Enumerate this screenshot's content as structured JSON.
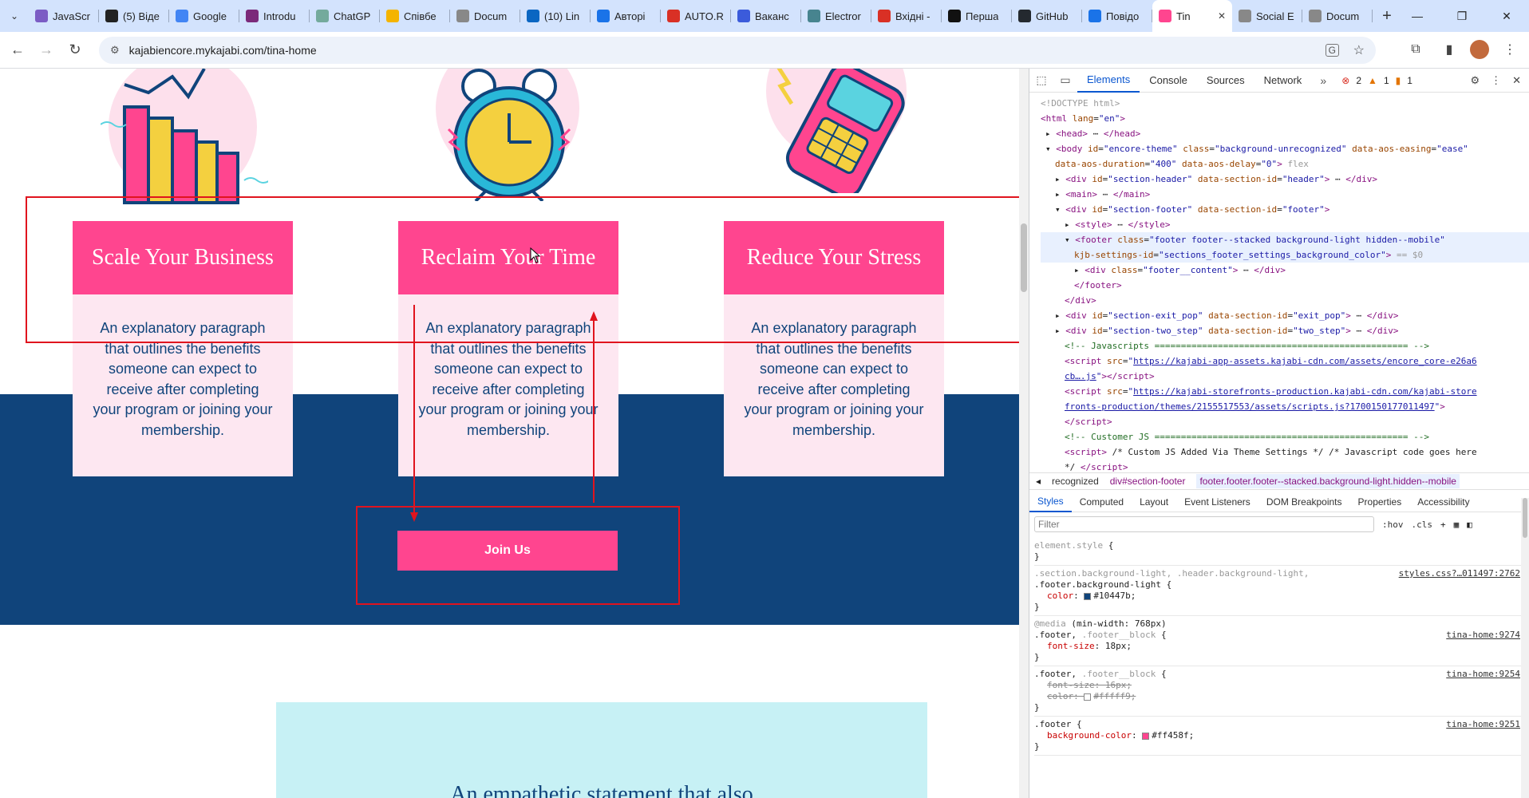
{
  "tabs": [
    {
      "title": "JavaScr",
      "icon": "javascript-favicon",
      "color": "#7b5cc4"
    },
    {
      "title": "(5) Віде",
      "icon": "it-favicon",
      "color": "#222222"
    },
    {
      "title": "Google",
      "icon": "google-translate-favicon",
      "color": "#4285f4"
    },
    {
      "title": "Introdu",
      "icon": "course-favicon",
      "color": "#7b2a7a"
    },
    {
      "title": "ChatGP",
      "icon": "chatgpt-favicon",
      "color": "#74aa9c"
    },
    {
      "title": "Співбе",
      "icon": "google-drive-favicon",
      "color": "#f4b400"
    },
    {
      "title": "Docum",
      "icon": "document-favicon",
      "color": "#888888"
    },
    {
      "title": "(10) Lin",
      "icon": "linkedin-favicon",
      "color": "#0a66c2"
    },
    {
      "title": "Авторі",
      "icon": "check-favicon",
      "color": "#1a73e8"
    },
    {
      "title": "AUTO.R",
      "icon": "auto-ria-favicon",
      "color": "#d93025"
    },
    {
      "title": "Ваканс",
      "icon": "djinni-favicon",
      "color": "#3b5bdb"
    },
    {
      "title": "Electror",
      "icon": "electron-favicon",
      "color": "#47848f"
    },
    {
      "title": "Вхідні -",
      "icon": "gmail-favicon",
      "color": "#d93025"
    },
    {
      "title": "Перша",
      "icon": "dou-favicon",
      "color": "#111111"
    },
    {
      "title": "GitHub",
      "icon": "github-favicon",
      "color": "#24292f"
    },
    {
      "title": "Повідо",
      "icon": "message-favicon",
      "color": "#1a73e8"
    },
    {
      "title": "Tin",
      "icon": "kajabi-favicon",
      "color": "#ff458f",
      "active": true
    },
    {
      "title": "Social E",
      "icon": "social-favicon",
      "color": "#888888"
    },
    {
      "title": "Docum",
      "icon": "document-favicon",
      "color": "#888888"
    }
  ],
  "browser": {
    "url": "kajabiencore.mykajabi.com/tina-home"
  },
  "page": {
    "cards": [
      {
        "heading": "Scale Your Business",
        "body": "An explanatory paragraph that outlines the benefits someone can expect to receive after completing your program or joining your membership."
      },
      {
        "heading": "Reclaim Your Time",
        "body": "An explanatory paragraph that outlines the benefits someone can expect to receive after completing your program or joining your membership."
      },
      {
        "heading": "Reduce Your Stress",
        "body": "An explanatory paragraph that outlines the benefits someone can expect to receive after completing your program or joining your membership."
      }
    ],
    "join_label": "Join Us",
    "empathy_text": "An empathetic statement that also",
    "colors": {
      "navy": "#10447b",
      "pink": "#ff458f",
      "annotation": "#e0141e"
    }
  },
  "devtools": {
    "tabs": [
      "Elements",
      "Console",
      "Sources",
      "Network"
    ],
    "badges": {
      "errors": "2",
      "warnings": "1",
      "issues": "1"
    },
    "crumbs": [
      "recognized",
      "div#section-footer",
      "footer.footer.footer--stacked.background-light.hidden--mobile"
    ],
    "subtabs": [
      "Styles",
      "Computed",
      "Layout",
      "Event Listeners",
      "DOM Breakpoints",
      "Properties",
      "Accessibility"
    ],
    "filter_placeholder": "Filter",
    "hov": ":hov",
    "cls": ".cls"
  }
}
